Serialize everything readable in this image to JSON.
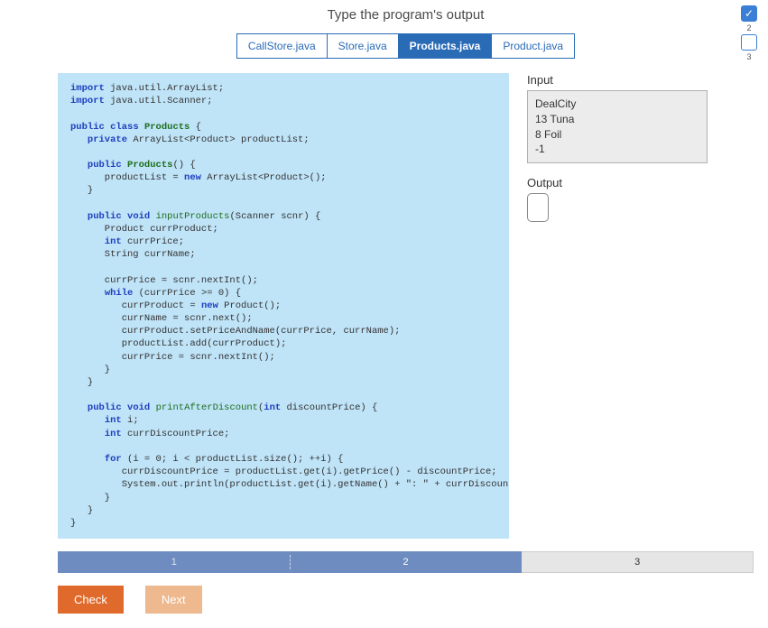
{
  "title": "Type the program's output",
  "tabs": [
    {
      "label": "CallStore.java",
      "active": false
    },
    {
      "label": "Store.java",
      "active": false
    },
    {
      "label": "Products.java",
      "active": true
    },
    {
      "label": "Product.java",
      "active": false
    }
  ],
  "code": {
    "kw_import": "import",
    "kw_public": "public",
    "kw_private": "private",
    "kw_class": "class",
    "kw_void": "void",
    "kw_new": "new",
    "kw_int": "int",
    "kw_while": "while",
    "kw_for": "for",
    "cls_products": "Products",
    "imp1": " java.util.ArrayList;",
    "imp2": " java.util.Scanner;",
    "line_class": " {",
    "line_priv": " ArrayList<Product> productList;",
    "ctor": "() {",
    "ctor_body": "      productList = ",
    "ctor_body2": " ArrayList<Product>();",
    "close_brace": "   }",
    "m_input": "inputProducts",
    "m_input_args": "(Scanner scnr) {",
    "ip1": "      Product currProduct;",
    "ip2": " currPrice;",
    "ip3": "      String currName;",
    "ip4": "      currPrice = scnr.nextInt();",
    "ip5": " (currPrice >= 0) {",
    "ip6": "         currProduct = ",
    "ip6b": " Product();",
    "ip7": "         currName = scnr.next();",
    "ip8": "         currProduct.setPriceAndName(currPrice, currName);",
    "ip9": "         productList.add(currProduct);",
    "ip10": "         currPrice = scnr.nextInt();",
    "ip_close": "      }",
    "m_print": "printAfterDiscount",
    "m_print_args": " discountPrice) {",
    "pd1": " i;",
    "pd2": " currDiscountPrice;",
    "pd3": " (i = 0; i < productList.size(); ++i) {",
    "pd4": "         currDiscountPrice = productList.get(i).getPrice() - discountPrice;",
    "pd5": "         System.out.println(productList.get(i).getName() + \": \" + currDiscountPrice);",
    "final_close": "}"
  },
  "io": {
    "input_label": "Input",
    "input_lines": [
      "DealCity",
      "13 Tuna",
      "8 Foil",
      "-1"
    ],
    "output_label": "Output",
    "output_text": ""
  },
  "progress": {
    "steps": [
      "1",
      "2",
      "3"
    ],
    "current": 2
  },
  "buttons": {
    "check": "Check",
    "next": "Next"
  },
  "side": {
    "n1": "2",
    "n2": "3",
    "check": "✓"
  }
}
